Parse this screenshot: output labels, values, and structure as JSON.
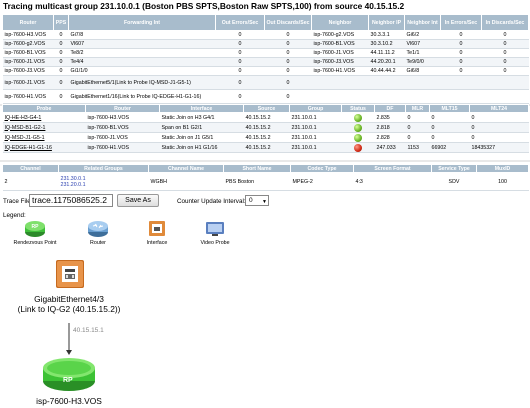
{
  "title": "Tracing multicast group 231.10.0.1 (Boston PBS SPTS,Boston Raw SPTS,100) from source 40.15.15.2",
  "routers_table": {
    "headers": [
      "Router",
      "PPS",
      "Forwarding Int",
      "Out Errors/Sec",
      "Out Discards/Sec",
      "Neighbor",
      "Neighbor IP",
      "Neighbor Int",
      "In Errors/Sec",
      "In Discards/Sec"
    ],
    "rows": [
      [
        "isp-7600-H3.VOS",
        "0",
        "Gi7/8",
        "0",
        "0",
        "isp-7600-g2.VOS",
        "30.3.3.1",
        "Gi6/2",
        "0",
        "0"
      ],
      [
        "isp-7600-g2.VOS",
        "0",
        "Vl607",
        "0",
        "0",
        "isp-7600-B1.VOS",
        "30.3.10.2",
        "Vl607",
        "0",
        "0"
      ],
      [
        "isp-7600-B1.VOS",
        "0",
        "Te8/2",
        "0",
        "0",
        "isp-7600-J1.VOS",
        "44.11.11.2",
        "Te1/1",
        "0",
        "0"
      ],
      [
        "isp-7600-J1.VOS",
        "0",
        "Te4/4",
        "0",
        "0",
        "isp-7600-J3.VOS",
        "44.20.20.1",
        "Te9/0/0",
        "0",
        "0"
      ],
      [
        "isp-7600-J3.VOS",
        "0",
        "Gi1/1/0",
        "0",
        "0",
        "isp-7600-H1.VOS",
        "40.44.44.2",
        "Gi6/8",
        "0",
        "0"
      ],
      [
        "isp-7600-J1.VOS",
        "0",
        "GigabitEthernet5/1(Link to Probe IQ-MSD-J1-G5-1)",
        "0",
        "0",
        "",
        "",
        "",
        "",
        ""
      ],
      [
        "isp-7600-H1.VOS",
        "0",
        "GigabitEthernet1/16(Link to Probe IQ-EDGE-H1-G1-16)",
        "0",
        "0",
        "",
        "",
        "",
        "",
        ""
      ]
    ]
  },
  "probe_table": {
    "headers": [
      "Probe",
      "Router",
      "Interface",
      "Source",
      "Group",
      "Status",
      "DF",
      "MLR",
      "MLT15",
      "MLT24"
    ],
    "rows": [
      {
        "probe": "IQ-HE-H3-G4-1",
        "router": "isp-7600-H3.VOS",
        "interface": "Static Join on H3 G4/1",
        "source": "40.15.15.2",
        "group": "231.10.0.1",
        "status": "green",
        "df": "2.835",
        "mlr": "0",
        "mlt15": "0",
        "mlt24": "0"
      },
      {
        "probe": "IQ-MSD-B1-G2-1",
        "router": "isp-7600-B1.VOS",
        "interface": "Span on B1 G2/1",
        "source": "40.15.15.2",
        "group": "231.10.0.1",
        "status": "green",
        "df": "2.818",
        "mlr": "0",
        "mlt15": "0",
        "mlt24": "0"
      },
      {
        "probe": "IQ-MSD-J1-G5-1",
        "router": "isp-7600-J1.VOS",
        "interface": "Static Join on J1 G5/1",
        "source": "40.15.15.2",
        "group": "231.10.0.1",
        "status": "green",
        "df": "2.828",
        "mlr": "0",
        "mlt15": "0",
        "mlt24": "0"
      },
      {
        "probe": "IQ-EDGE-H1-G1-16",
        "router": "isp-7600-H1.VOS",
        "interface": "Static Join on H1 G1/16",
        "source": "40.15.15.2",
        "group": "231.10.0.1",
        "status": "red",
        "df": "247.033",
        "mlr": "1153",
        "mlt15": "66902",
        "mlt24": "18435327"
      }
    ]
  },
  "channel_table": {
    "headers": [
      "Channel",
      "Related Groups",
      "Channel Name",
      "Short Name",
      "Codec Type",
      "Screen Format",
      "Service Type",
      "MuxID"
    ],
    "row": {
      "channel": "2",
      "groups": [
        "231.30.0.1",
        "231.20.0.1"
      ],
      "name": "WGBH",
      "short": "PBS Boston",
      "codec": "MPEG-2",
      "format": "4:3",
      "service": "SDV",
      "muxid": "100"
    }
  },
  "trace": {
    "label": "Trace File:",
    "value": "trace.1175086525.2",
    "save_label": "Save As",
    "counter_label": "Counter Update Interval:",
    "counter_value": "0"
  },
  "legend": {
    "title": "Legend:",
    "items": [
      "Rendezvous Point",
      "Router",
      "Interface",
      "Video Probe"
    ]
  },
  "diagram": {
    "interface_label_1": "GigabitEthernet4/3",
    "interface_label_2": "(Link to IQ-G2 (40.15.15.2))",
    "edge_label": "40.15.15.1",
    "rp_text": "RP",
    "router_label": "isp-7600-H3.VOS"
  },
  "colors": {
    "header_bg": "#a8bccc",
    "status_green": "#6bb526",
    "status_red": "#d12a14",
    "rp_green": "#3fbf3a",
    "interface_orange": "#e08a3a",
    "router_blue": "#6a9fd0"
  }
}
